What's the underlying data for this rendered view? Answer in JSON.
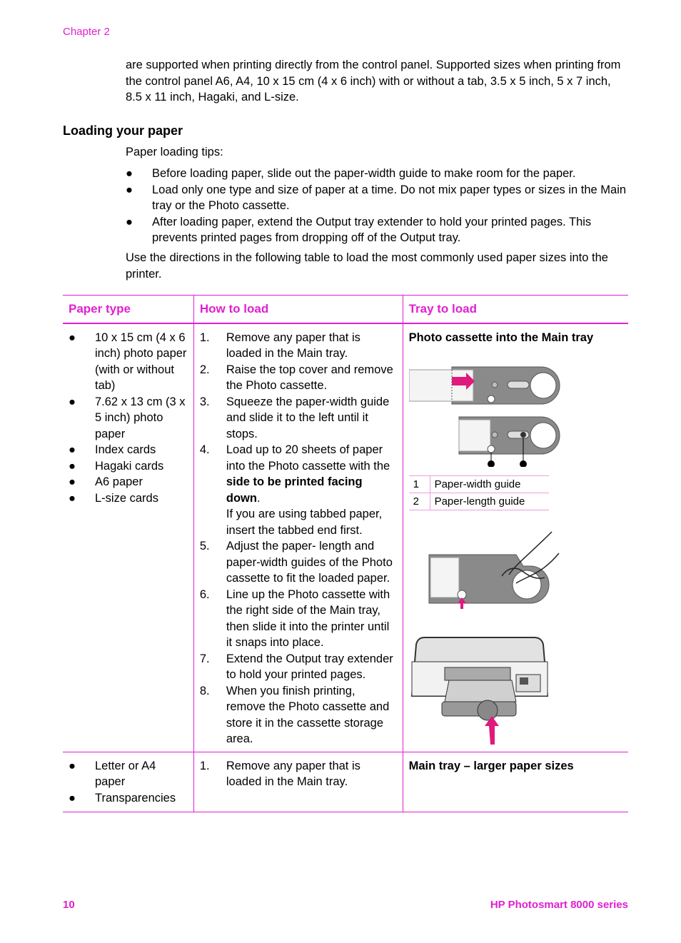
{
  "header": {
    "chapter": "Chapter 2"
  },
  "intro_text": "are supported when printing directly from the control panel. Supported sizes when printing from the control panel A6, A4, 10 x 15 cm (4 x 6 inch) with or without a tab, 3.5 x 5 inch, 5 x 7 inch, 8.5 x 11 inch, Hagaki, and L-size.",
  "section": {
    "title": "Loading your paper",
    "tips_label": "Paper loading tips:",
    "tips": [
      "Before loading paper, slide out the paper-width guide to make room for the paper.",
      "Load only one type and size of paper at a time. Do not mix paper types or sizes in the Main tray or the Photo cassette.",
      "After loading paper, extend the Output tray extender to hold your printed pages. This prevents printed pages from dropping off of the Output tray."
    ],
    "bullet": "●",
    "use_text": "Use the directions in the following table to load the most commonly used paper sizes into the printer."
  },
  "table": {
    "headers": [
      "Paper type",
      "How to load",
      "Tray to load"
    ],
    "rows": [
      {
        "paper_types": [
          "10 x 15 cm (4 x 6 inch) photo paper (with or without tab)",
          "7.62 x 13 cm (3 x 5 inch) photo paper",
          "Index cards",
          "Hagaki cards",
          "A6 paper",
          "L-size cards"
        ],
        "steps": [
          {
            "num": "1.",
            "text": "Remove any paper that is loaded in the Main tray."
          },
          {
            "num": "2.",
            "text": "Raise the top cover and remove the Photo cassette."
          },
          {
            "num": "3.",
            "text": "Squeeze the paper-width guide and slide it to the left until it stops."
          },
          {
            "num": "4.",
            "text_before": "Load up to 20 sheets of paper into the Photo cassette with the ",
            "text_bold": "side to be printed facing down",
            "text_after": ".",
            "note": "If you are using tabbed paper, insert the tabbed end first."
          },
          {
            "num": "5.",
            "text": "Adjust the paper- length and paper-width guides of the Photo cassette to fit the loaded paper."
          },
          {
            "num": "6.",
            "text": "Line up the Photo cassette with the right side of the Main tray, then slide it into the printer until it snaps into place."
          },
          {
            "num": "7.",
            "text": "Extend the Output tray extender to hold your printed pages."
          },
          {
            "num": "8.",
            "text": "When you finish printing, remove the Photo cassette and store it in the cassette storage area."
          }
        ],
        "tray_title": "Photo cassette into the Main tray",
        "callouts": [
          {
            "num": "1",
            "label": "Paper-width guide"
          },
          {
            "num": "2",
            "label": "Paper-length guide"
          }
        ]
      },
      {
        "paper_types": [
          "Letter or A4 paper",
          "Transparencies"
        ],
        "steps": [
          {
            "num": "1.",
            "text": "Remove any paper that is loaded in the Main tray."
          }
        ],
        "tray_title": "Main tray – larger paper sizes"
      }
    ]
  },
  "footer": {
    "page_number": "10",
    "product": "HP Photosmart 8000 series"
  },
  "colors": {
    "accent": "#e020d0",
    "arrow": "#e0197d"
  }
}
